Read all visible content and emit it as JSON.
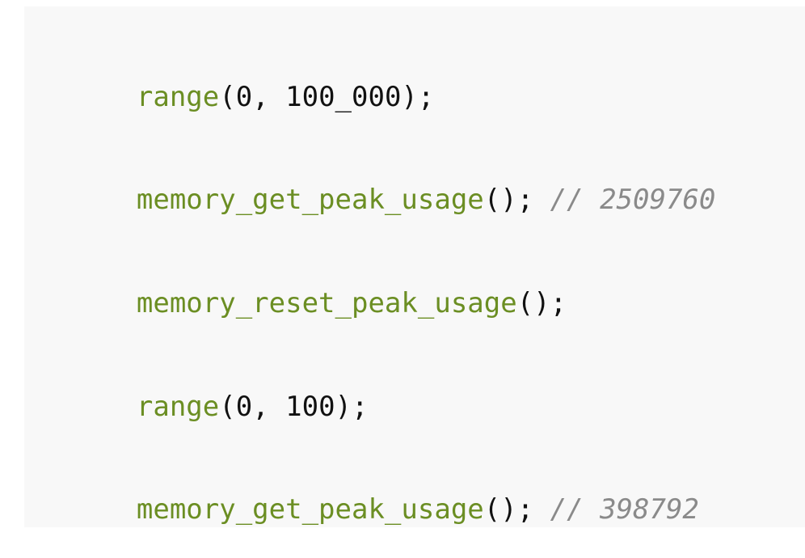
{
  "code_lines": [
    {
      "fn": "range",
      "args": "(0, 100_000);",
      "comment": ""
    },
    {
      "fn": "memory_get_peak_usage",
      "args": "();",
      "comment": "// 2509760"
    },
    {
      "fn": "memory_reset_peak_usage",
      "args": "();",
      "comment": ""
    },
    {
      "fn": "range",
      "args": "(0, 100);",
      "comment": ""
    },
    {
      "fn": "memory_get_peak_usage",
      "args": "();",
      "comment": "// 398792"
    }
  ],
  "colors": {
    "function": "#6b8e23",
    "text": "#111111",
    "comment": "#8a8a8a",
    "background": "#f8f8f8"
  }
}
